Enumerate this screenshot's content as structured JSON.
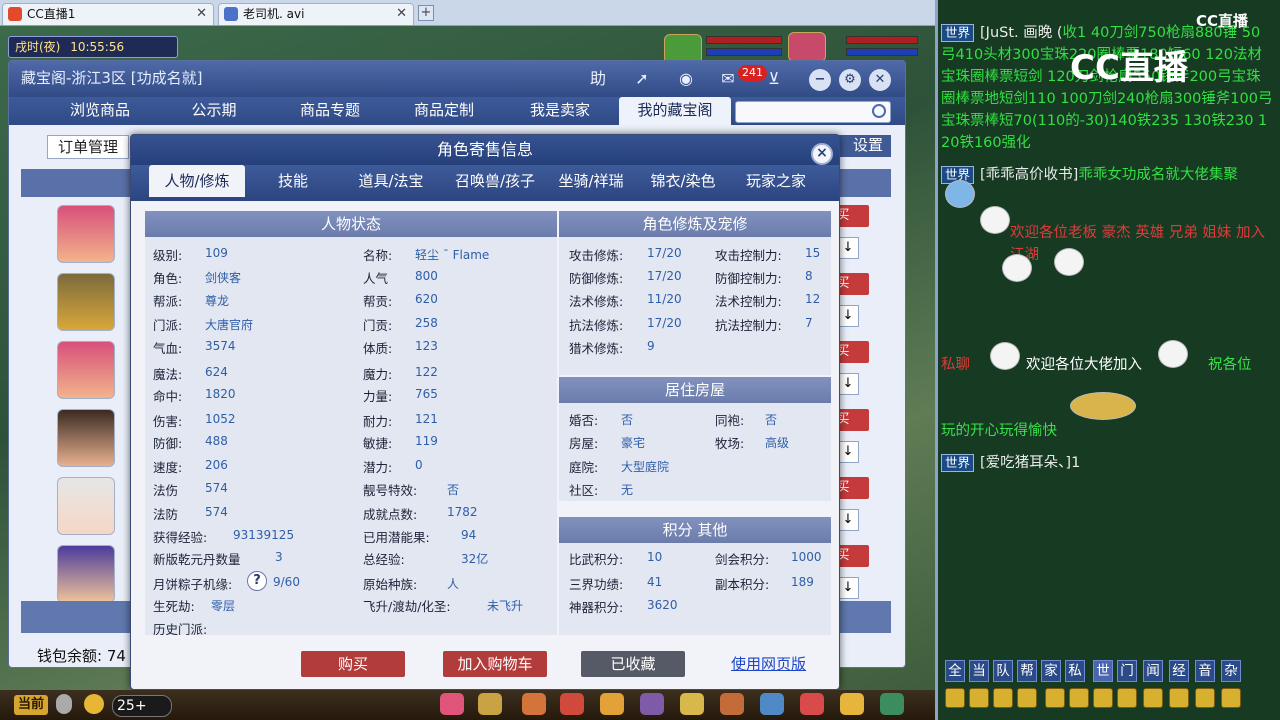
{
  "browser_tabs": [
    {
      "label": "CC直播1",
      "icon": "cc-live-icon"
    },
    {
      "label": "老司机. avi",
      "icon": "video-icon"
    }
  ],
  "game": {
    "time_period": "戌时(夜)",
    "clock": "10:55:56",
    "current_btn": "当前",
    "online_count": "25+"
  },
  "cbg": {
    "title": "藏宝阁-浙江3区 [功成名就]",
    "help_label": "助",
    "message_badge": "241",
    "nav": [
      "浏览商品",
      "公示期",
      "商品专题",
      "商品定制",
      "我是卖家",
      "我的藏宝阁"
    ],
    "order_btn": "订单管理",
    "settings_btn": "设置",
    "row_buy_label": "买",
    "row_arrow": "↓",
    "wallet_label": "钱包余额: 74"
  },
  "dialog": {
    "title": "角色寄售信息",
    "close": "×",
    "tabs": [
      "人物/修炼",
      "技能",
      "道具/法宝",
      "召唤兽/孩子",
      "坐骑/祥瑞",
      "锦衣/染色",
      "玩家之家"
    ],
    "status_title": "人物状态",
    "status_left": [
      {
        "label": "级别:",
        "value": "109"
      },
      {
        "label": "角色:",
        "value": "剑侠客"
      },
      {
        "label": "帮派:",
        "value": "尊龙"
      },
      {
        "label": "门派:",
        "value": "大唐官府"
      },
      {
        "label": "气血:",
        "value": "3574"
      },
      {
        "label": "魔法:",
        "value": "624"
      },
      {
        "label": "命中:",
        "value": "1820"
      },
      {
        "label": "伤害:",
        "value": "1052"
      },
      {
        "label": "防御:",
        "value": "488"
      },
      {
        "label": "速度:",
        "value": "206"
      },
      {
        "label": "法伤",
        "value": "574"
      },
      {
        "label": "法防",
        "value": "574"
      },
      {
        "label": "获得经验:",
        "value": "93139125"
      },
      {
        "label": "新版乾元丹数量",
        "value": "3"
      },
      {
        "label": "月饼粽子机缘:",
        "value": "9/60"
      },
      {
        "label": "生死劫:",
        "value": "零层"
      },
      {
        "label": "历史门派:",
        "value": ""
      }
    ],
    "status_right": [
      {
        "label": "名称:",
        "value": "轻尘 ˉ Flame"
      },
      {
        "label": "人气",
        "value": "800"
      },
      {
        "label": "帮贡:",
        "value": "620"
      },
      {
        "label": "门贡:",
        "value": "258"
      },
      {
        "label": "体质:",
        "value": "123"
      },
      {
        "label": "魔力:",
        "value": "122"
      },
      {
        "label": "力量:",
        "value": "765"
      },
      {
        "label": "耐力:",
        "value": "121"
      },
      {
        "label": "敏捷:",
        "value": "119"
      },
      {
        "label": "潜力:",
        "value": "0"
      },
      {
        "label": "靓号特效:",
        "value": "否"
      },
      {
        "label": "成就点数:",
        "value": "1782"
      },
      {
        "label": "已用潜能果:",
        "value": "94"
      },
      {
        "label": "总经验:",
        "value": "32亿"
      },
      {
        "label": "原始种族:",
        "value": "人"
      },
      {
        "label": "飞升/渡劫/化圣:",
        "value": "未飞升"
      }
    ],
    "cultivation_title": "角色修炼及宠修",
    "cultivation": [
      {
        "l1": "攻击修炼:",
        "v1": "17/20",
        "l2": "攻击控制力:",
        "v2": "15"
      },
      {
        "l1": "防御修炼:",
        "v1": "17/20",
        "l2": "防御控制力:",
        "v2": "8"
      },
      {
        "l1": "法术修炼:",
        "v1": "11/20",
        "l2": "法术控制力:",
        "v2": "12"
      },
      {
        "l1": "抗法修炼:",
        "v1": "17/20",
        "l2": "抗法控制力:",
        "v2": "7"
      },
      {
        "l1": "猎术修炼:",
        "v1": "9",
        "l2": "",
        "v2": ""
      }
    ],
    "house_title": "居住房屋",
    "house": [
      {
        "l1": "婚否:",
        "v1": "否",
        "l2": "同袍:",
        "v2": "否"
      },
      {
        "l1": "房屋:",
        "v1": "豪宅",
        "l2": "牧场:",
        "v2": "高级"
      },
      {
        "l1": "庭院:",
        "v1": "大型庭院",
        "l2": "",
        "v2": ""
      },
      {
        "l1": "社区:",
        "v1": "无",
        "l2": "",
        "v2": ""
      }
    ],
    "points_title": "积分 其他",
    "points": [
      {
        "l1": "比武积分:",
        "v1": "10",
        "l2": "剑会积分:",
        "v2": "1000"
      },
      {
        "l1": "三界功绩:",
        "v1": "41",
        "l2": "副本积分:",
        "v2": "189"
      },
      {
        "l1": "神器积分:",
        "v1": "3620",
        "l2": "",
        "v2": ""
      }
    ],
    "btn_buy": "购买",
    "btn_cart": "加入购物车",
    "btn_fav": "已收藏",
    "web_link": "使用网页版"
  },
  "chat": {
    "logo_big": "CC直播",
    "logo_small": "CC直播",
    "messages": [
      {
        "channel": "世界",
        "name": "[JuSt. 画晚 (",
        "text": "收1 40刀剑750枪扇880锤 50弓410头材300宝珠220圈棒票180短60 120法材宝珠圈棒票短剑  120刀剑枪扇550锤斧200弓宝珠圈棒票地短剑110 100刀剑240枪扇300锤斧100弓宝珠票棒短70(110的-30)140铁235 130铁230 120铁160强化"
      },
      {
        "channel": "世界",
        "name": "[乖乖高价收书]",
        "text": "乖乖女功成名就大佬集聚"
      },
      {
        "channel": "",
        "name": "",
        "text": "欢迎各位老板 豪杰 英雄 兄弟 姐妹 加入江湖 "
      },
      {
        "channel": "",
        "name": "",
        "text": "私聊"
      },
      {
        "channel": "",
        "name": "",
        "text": "欢迎各位大佬加入"
      },
      {
        "channel": "",
        "name": "",
        "text": "祝各位"
      },
      {
        "channel": "",
        "name": "",
        "text": "玩的开心玩得愉快"
      },
      {
        "channel": "世界",
        "name": "[爱吃猪耳朵、]1",
        "text": ""
      }
    ],
    "channel_buttons": [
      "全",
      "当",
      "队",
      "帮",
      "家",
      "私",
      "世",
      "门",
      "闻",
      "经",
      "音",
      "杂"
    ]
  }
}
